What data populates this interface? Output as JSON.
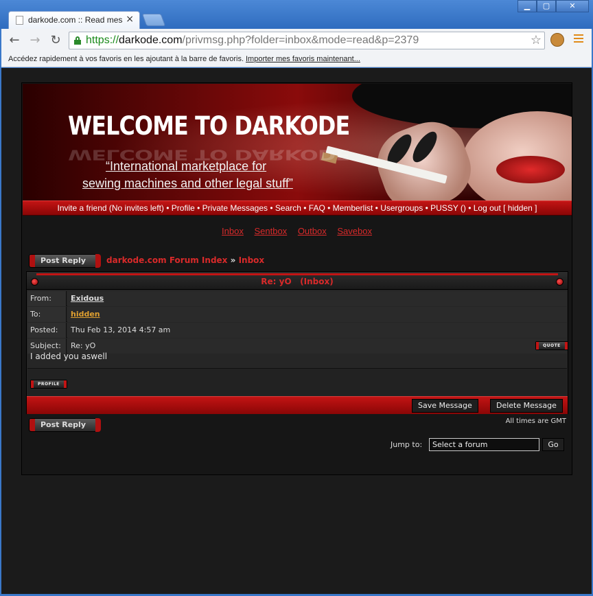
{
  "browser": {
    "tab_title": "darkode.com :: Read messag",
    "tab_close": "×",
    "url_scheme": "https://",
    "url_host": "darkode.com",
    "url_path": "/privmsg.php?folder=inbox&mode=read&p=2379",
    "bookmark_msg": "Accédez rapidement à vos favoris en les ajoutant à la barre de favoris.",
    "bookmark_link": "Importer mes favoris maintenant..."
  },
  "banner": {
    "headline": "WELCOME TO DARKODE",
    "tagline_1": "“International marketplace for",
    "tagline_2": "sewing machines and other legal stuff”"
  },
  "navbar": {
    "text": "Invite a friend (No invites left) • Profile • Private Messages • Search • FAQ • Memberlist • Usergroups • PUSSY () • Log out [ hidden ]"
  },
  "folders": [
    "Inbox",
    "Sentbox",
    "Outbox",
    "Savebox"
  ],
  "buttons": {
    "post_reply": "Post Reply",
    "quote": "QUOTE",
    "profile": "PROFILE",
    "save_message": "Save Message",
    "delete_message": "Delete Message",
    "go": "Go"
  },
  "breadcrumb": {
    "forum_index": "darkode.com Forum Index",
    "separator": "»",
    "current": "Inbox"
  },
  "message": {
    "header_title": "Re: yO   (Inbox)",
    "from_label": "From:",
    "from_value": "Exidous",
    "to_label": "To:",
    "to_value": "hidden",
    "posted_label": "Posted:",
    "posted_value": "Thu Feb 13, 2014 4:57 am",
    "subject_label": "Subject:",
    "subject_value": "Re: yO",
    "body": "I added you aswell"
  },
  "footer": {
    "times": "All times are GMT",
    "jump_label": "Jump to:",
    "jump_value": "Select a forum"
  },
  "colors": {
    "accent_red": "#c21414",
    "link_red": "#d92a2a",
    "gold": "#e0a030",
    "page_bg": "#1b1b1b"
  }
}
